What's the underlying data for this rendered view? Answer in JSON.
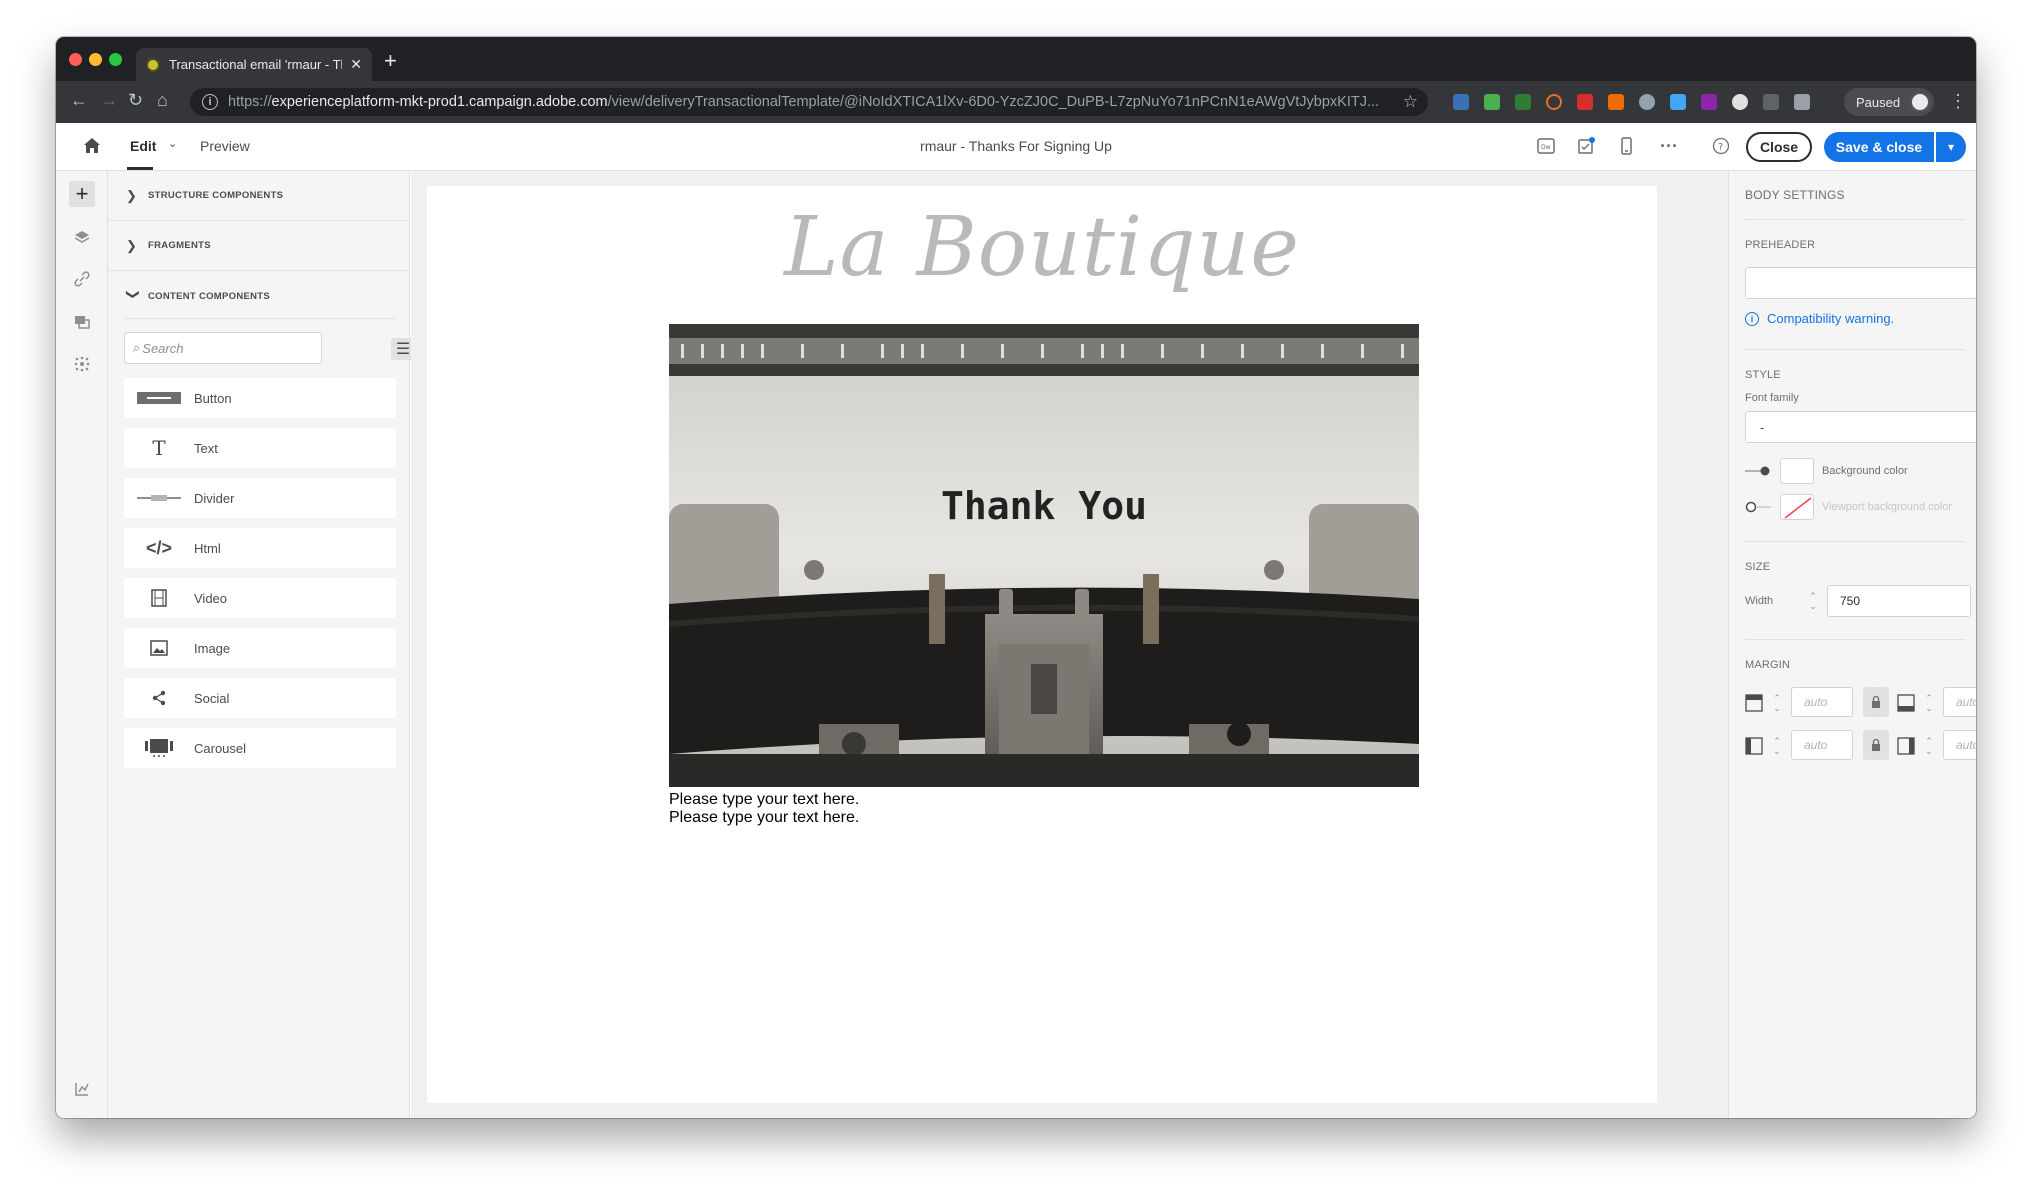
{
  "browser": {
    "tab_title": "Transactional email 'rmaur - Th",
    "url_prefix": "https://",
    "url_host": "experienceplatform-mkt-prod1.campaign.adobe.com",
    "url_path": "/view/deliveryTransactionalTemplate/@iNoIdXTICA1lXv-6D0-YzcZJ0C_DuPB-L7zpNuYo71nPCnN1eAWgVtJybpxKITJ...",
    "profile_status": "Paused"
  },
  "header": {
    "tabs": {
      "edit": "Edit",
      "preview": "Preview"
    },
    "document_title": "rmaur - Thanks For Signing Up",
    "close_label": "Close",
    "save_label": "Save & close"
  },
  "components_panel": {
    "sections": {
      "structure": "STRUCTURE COMPONENTS",
      "fragments": "FRAGMENTS",
      "content": "CONTENT COMPONENTS"
    },
    "search_placeholder": "Search",
    "items": [
      {
        "label": "Button",
        "icon": "button-icon"
      },
      {
        "label": "Text",
        "icon": "text-icon"
      },
      {
        "label": "Divider",
        "icon": "divider-icon"
      },
      {
        "label": "Html",
        "icon": "code-icon"
      },
      {
        "label": "Video",
        "icon": "film-icon"
      },
      {
        "label": "Image",
        "icon": "image-icon"
      },
      {
        "label": "Social",
        "icon": "share-icon"
      },
      {
        "label": "Carousel",
        "icon": "carousel-icon"
      }
    ]
  },
  "email": {
    "logo_text": "La Boutique",
    "hero_text": "Thank You",
    "body_lines": [
      "Please type your text here.",
      "Please type your text here."
    ]
  },
  "settings": {
    "title": "BODY SETTINGS",
    "preheader_label": "PREHEADER",
    "preheader_value": "",
    "compat_warning": "Compatibility warning.",
    "style_label": "STYLE",
    "font_family_label": "Font family",
    "font_family_value": "-",
    "background_color_label": "Background color",
    "viewport_bg_label": "Viewport background color",
    "size_label": "SIZE",
    "width_label": "Width",
    "width_value": "750",
    "margin_label": "MARGIN",
    "margin_placeholder": "auto"
  },
  "colors": {
    "accent": "#1473e6",
    "chrome_dark": "#202124",
    "panel_bg": "#f5f5f5"
  }
}
